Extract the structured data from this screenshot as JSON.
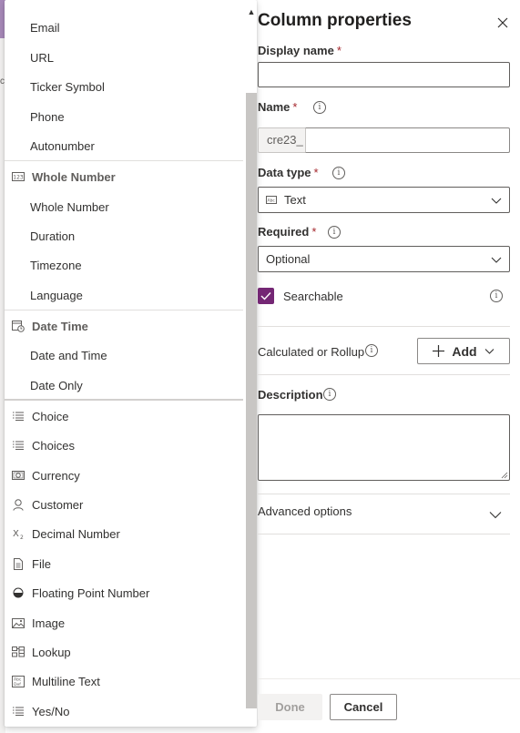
{
  "background": {
    "edge_text": "c"
  },
  "dropdown": {
    "group1_items": [
      "Email",
      "URL",
      "Ticker Symbol",
      "Phone",
      "Autonumber"
    ],
    "whole_number_header": "Whole Number",
    "group2_items": [
      "Whole Number",
      "Duration",
      "Timezone",
      "Language"
    ],
    "date_time_header": "Date Time",
    "group3_items": [
      "Date and Time",
      "Date Only"
    ],
    "types": [
      {
        "label": "Choice",
        "icon": "list-icon"
      },
      {
        "label": "Choices",
        "icon": "list-icon"
      },
      {
        "label": "Currency",
        "icon": "currency-icon"
      },
      {
        "label": "Customer",
        "icon": "person-icon"
      },
      {
        "label": "Decimal Number",
        "icon": "subscript-x-icon"
      },
      {
        "label": "File",
        "icon": "file-icon"
      },
      {
        "label": "Floating Point Number",
        "icon": "half-circle-icon"
      },
      {
        "label": "Image",
        "icon": "image-icon"
      },
      {
        "label": "Lookup",
        "icon": "lookup-icon"
      },
      {
        "label": "Multiline Text",
        "icon": "multiline-text-icon"
      },
      {
        "label": "Yes/No",
        "icon": "list-icon"
      }
    ]
  },
  "panel": {
    "title": "Column properties",
    "display_name_label": "Display name",
    "display_name_value": "",
    "name_label": "Name",
    "name_prefix": "cre23_",
    "data_type_label": "Data type",
    "data_type_value": "Text",
    "required_label": "Required",
    "required_value": "Optional",
    "searchable_label": "Searchable",
    "searchable_checked": true,
    "calculated_label": "Calculated or Rollup",
    "add_label": "Add",
    "description_label": "Description",
    "advanced_label": "Advanced options",
    "required_marker": "*",
    "info_glyph": "i",
    "done_label": "Done",
    "cancel_label": "Cancel"
  },
  "colors": {
    "accent": "#742774",
    "header_bg": "#a789b9",
    "required": "#a4262c"
  }
}
